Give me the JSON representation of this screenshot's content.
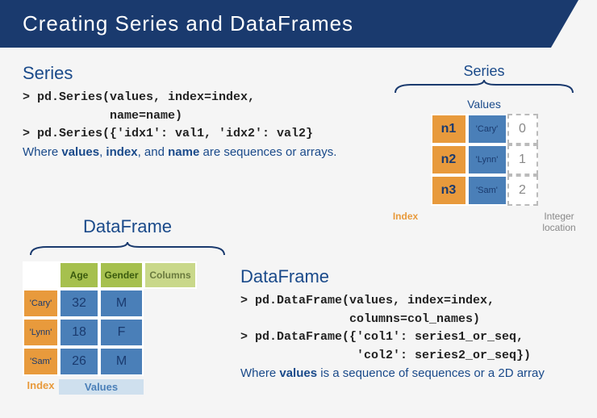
{
  "header": "Creating Series and DataFrames",
  "series": {
    "title": "Series",
    "code": "> pd.Series(values, index=index,\n            name=name)\n> pd.Series({'idx1': val1, 'idx2': val2}",
    "desc_pre": "Where ",
    "desc_b1": "values",
    "desc_mid1": ", ",
    "desc_b2": "index",
    "desc_mid2": ", and ",
    "desc_b3": "name",
    "desc_post": " are sequences or arrays."
  },
  "series_vis": {
    "title": "Series",
    "values_label": "Values",
    "rows": [
      {
        "idx": "n1",
        "val": "'Cary'",
        "iloc": "0"
      },
      {
        "idx": "n2",
        "val": "'Lynn'",
        "iloc": "1"
      },
      {
        "idx": "n3",
        "val": "'Sam'",
        "iloc": "2"
      }
    ],
    "index_label": "Index",
    "iloc_label": "Integer location"
  },
  "df_vis": {
    "title": "DataFrame",
    "col1": "Age",
    "col2": "Gender",
    "col_label": "Columns",
    "rows": [
      {
        "idx": "'Cary'",
        "c1": "32",
        "c2": "M"
      },
      {
        "idx": "'Lynn'",
        "c1": "18",
        "c2": "F"
      },
      {
        "idx": "'Sam'",
        "c1": "26",
        "c2": "M"
      }
    ],
    "index_label": "Index",
    "values_label": "Values"
  },
  "df": {
    "title": "DataFrame",
    "code": "> pd.DataFrame(values, index=index,\n               columns=col_names)\n> pd.DataFrame({'col1': series1_or_seq,\n                'col2': series2_or_seq})",
    "desc_pre": "Where ",
    "desc_b1": "values",
    "desc_post": " is a sequence of sequences or a 2D array"
  }
}
